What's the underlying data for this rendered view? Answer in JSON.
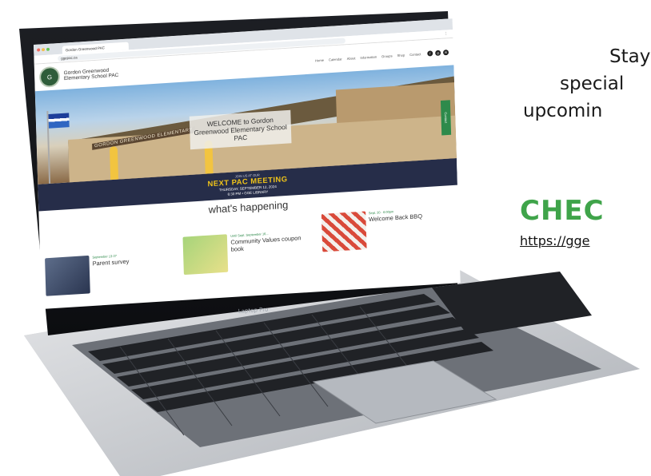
{
  "promo": {
    "line1": "Stay",
    "line2": "special",
    "line3": "upcomin",
    "cta": "CHEC",
    "url": "https://gge"
  },
  "laptop": {
    "model": "Laptop Pro"
  },
  "browser": {
    "tab_title": "Gordon Greenwood PAC",
    "address": "ggepac.ca"
  },
  "site": {
    "school_name": "Gordon Greenwood Elementary School PAC",
    "nav": [
      "Home",
      "Calendar",
      "About",
      "Information",
      "Groups",
      "Shop",
      "Contact"
    ],
    "social_icons": [
      "facebook-icon",
      "instagram-icon",
      "email-icon"
    ]
  },
  "hero": {
    "building_sign": "GORDON GREENWOOD ELEMENTARY",
    "welcome": "WELCOME to Gordon Greenwood Elementary School PAC",
    "side_tab": "Contact"
  },
  "meeting": {
    "kicker": "JOIN US AT OUR",
    "title": "NEXT PAC MEETING",
    "date": "THURSDAY, SEPTEMBER 12, 2024",
    "time_place": "6:30 PM • GGE LIBRARY"
  },
  "happening": {
    "heading": "what's happening",
    "cards": [
      {
        "date": "September 13-27",
        "title": "Parent survey"
      },
      {
        "date": "Until Sept. September 16...",
        "title": "Community Values coupon book"
      },
      {
        "date": "Sept. 20 · 6:00pm",
        "title": "Welcome Back BBQ"
      }
    ]
  },
  "colors": {
    "cta_green": "#3fa44a",
    "meeting_bg": "#262d49",
    "meeting_title": "#f0c419",
    "accent_green": "#2e8a4b"
  }
}
